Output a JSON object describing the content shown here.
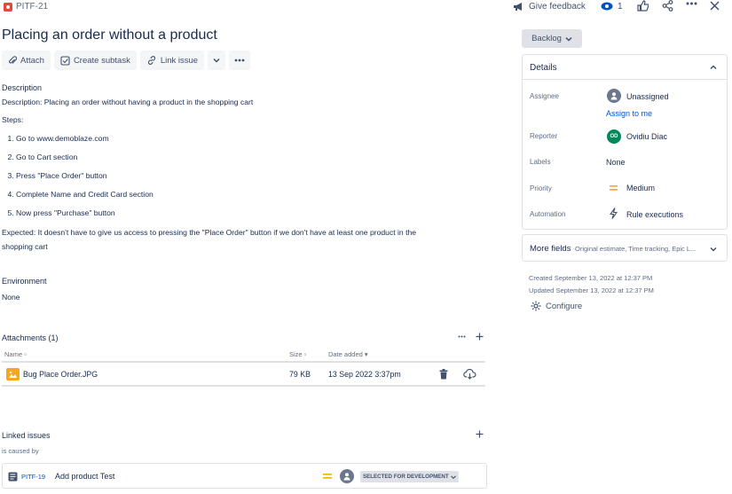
{
  "breadcrumb": {
    "issue_key": "PITF-21"
  },
  "header": {
    "feedback_label": "Give feedback",
    "watch_count": "1"
  },
  "issue": {
    "title": "Placing an order without a product"
  },
  "toolbar": {
    "attach": "Attach",
    "create_subtask": "Create subtask",
    "link_issue": "Link issue"
  },
  "description": {
    "heading": "Description",
    "line1": "Description: Placing an order without having a product in the shopping cart",
    "steps_heading": "Steps:",
    "steps": [
      "Go to www.demoblaze.com",
      "Go to Cart section",
      "Press \"Place Order\" button",
      "Complete Name and Credit Card section",
      "Now press \"Purchase\" button"
    ],
    "expected_line1": "Expected: It doesn't have to give us access to pressing the \"Place Order\" button if we don't have at least one product in the",
    "expected_line2": "shopping cart"
  },
  "environment": {
    "heading": "Environment",
    "value": "None"
  },
  "attachments": {
    "heading": "Attachments (1)",
    "columns": {
      "name": "Name",
      "size": "Size",
      "date": "Date added"
    },
    "files": [
      {
        "name": "Bug Place Order.JPG",
        "size": "79 KB",
        "date": "13 Sep 2022 3:37pm"
      }
    ]
  },
  "linked_issues": {
    "heading": "Linked issues",
    "relation": "is caused by",
    "items": [
      {
        "key": "PITF-19",
        "summary": "Add product Test",
        "status": "SELECTED FOR DEVELOPMENT"
      }
    ]
  },
  "status_button": {
    "label": "Backlog"
  },
  "details": {
    "heading": "Details",
    "assignee_label": "Assignee",
    "assignee_value": "Unassigned",
    "assign_to_me": "Assign to me",
    "reporter_label": "Reporter",
    "reporter_value": "Ovidiu Diac",
    "reporter_initials": "OD",
    "labels_label": "Labels",
    "labels_value": "None",
    "priority_label": "Priority",
    "priority_value": "Medium",
    "automation_label": "Automation",
    "automation_value": "Rule executions"
  },
  "more_fields": {
    "label": "More fields",
    "hint": "Original estimate, Time tracking, Epic L..."
  },
  "meta": {
    "created": "Created September 13, 2022 at 12:37 PM",
    "updated": "Updated September 13, 2022 at 12:37 PM",
    "configure": "Configure"
  },
  "colors": {
    "link": "#0052cc",
    "reporter_avatar": "#00875a",
    "priority": "#ffab00",
    "attachment_thumb": "#f5a623",
    "bug_icon": "#e5493a"
  }
}
